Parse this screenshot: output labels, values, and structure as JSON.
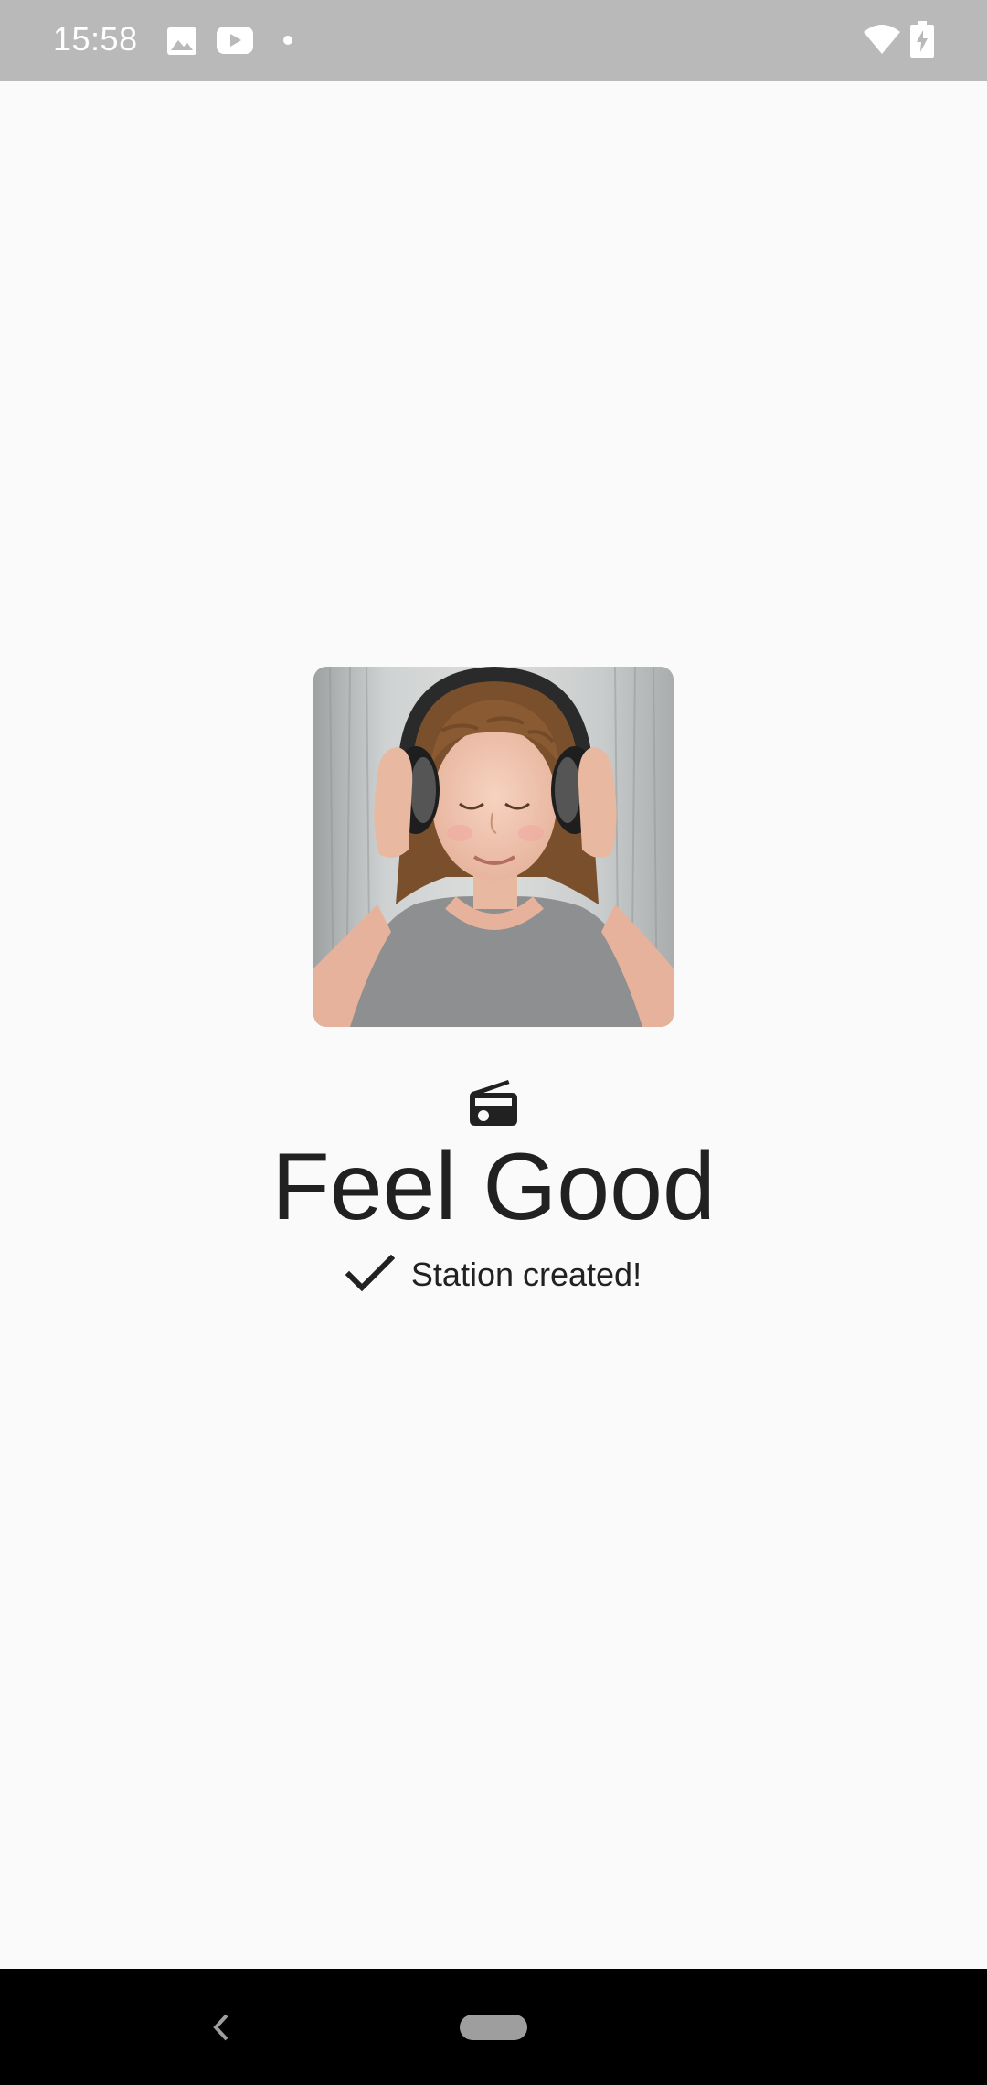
{
  "status_bar": {
    "time": "15:58",
    "left_icons": [
      "image-icon",
      "youtube-icon",
      "notification-dot-icon"
    ],
    "right_icons": [
      "wifi-icon",
      "battery-charging-icon"
    ]
  },
  "station": {
    "artwork": "girl-with-headphones-image",
    "type_icon": "radio-icon",
    "title": "Feel Good",
    "status_icon": "check-icon",
    "status_text": "Station created!"
  },
  "nav_bar": {
    "icons": [
      "back-icon",
      "home-pill-icon"
    ]
  },
  "colors": {
    "status_bar_bg": "#b9b9b9",
    "background": "#fafafa",
    "text": "#212121",
    "nav_bar_bg": "#000000"
  }
}
